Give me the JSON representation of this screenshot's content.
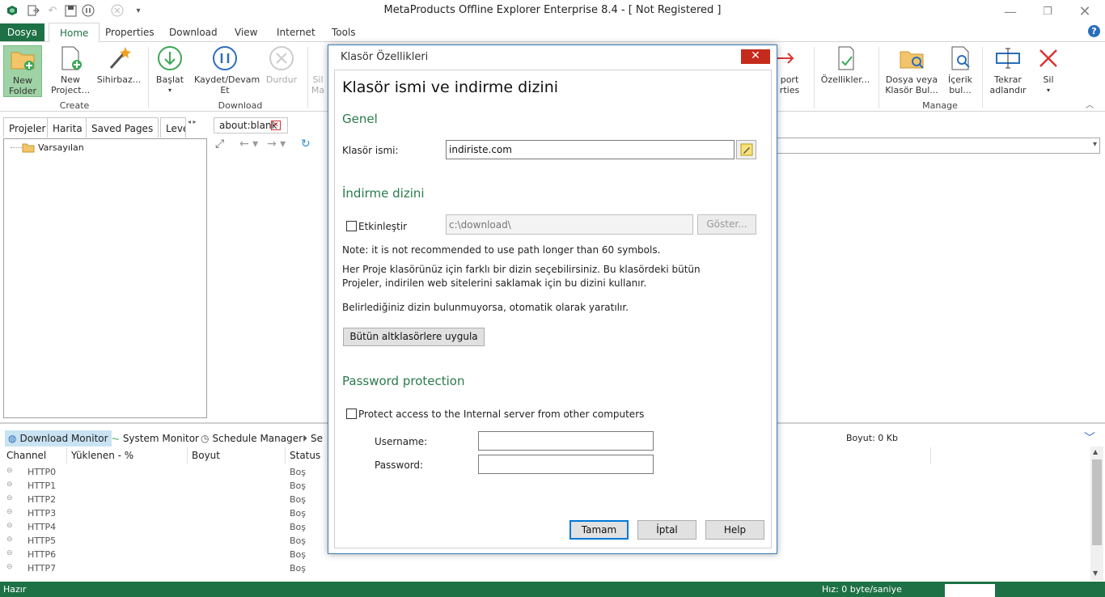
{
  "window": {
    "title": "MetaProducts Offline Explorer Enterprise 8.4 - [ Not Registered ]"
  },
  "ribbon": {
    "file_tab": "Dosya",
    "tabs": [
      "Home",
      "Properties",
      "Download",
      "View",
      "Internet",
      "Tools"
    ],
    "buttons": {
      "new_folder": "New Folder",
      "new_project": "New Project...",
      "wizard": "Sihirbaz...",
      "start": "Başlat",
      "save_resume": "Kaydet/Devam Et",
      "stop": "Durdur",
      "sil_partial": "Sil Ma",
      "export_partial": "port rties",
      "properties": "Özellikler...",
      "find_file": "Dosya veya Klasör Bul...",
      "find_content": "İçerik bul...",
      "rename": "Tekrar adlandır",
      "delete": "Sil"
    },
    "groups": {
      "create": "Create",
      "download": "Download",
      "manage": "Manage"
    }
  },
  "left_panel": {
    "tabs": [
      "Projeler",
      "Harita",
      "Saved Pages",
      "Leve"
    ],
    "tree_root": "Varsayılan"
  },
  "browser": {
    "tab_title": "about:blank"
  },
  "bottom_panel": {
    "tabs": [
      "Download Monitor",
      "System Monitor",
      "Schedule Manager",
      "Se"
    ],
    "size_label": "Boyut: 0 Kb",
    "columns": [
      "Channel",
      "Yüklenen - %",
      "Boyut",
      "Status"
    ],
    "rows": [
      {
        "channel": "HTTP0",
        "status": "Boş"
      },
      {
        "channel": "HTTP1",
        "status": "Boş"
      },
      {
        "channel": "HTTP2",
        "status": "Boş"
      },
      {
        "channel": "HTTP3",
        "status": "Boş"
      },
      {
        "channel": "HTTP4",
        "status": "Boş"
      },
      {
        "channel": "HTTP5",
        "status": "Boş"
      },
      {
        "channel": "HTTP6",
        "status": "Boş"
      },
      {
        "channel": "HTTP7",
        "status": "Boş"
      }
    ]
  },
  "status_bar": {
    "left": "Hazır",
    "speed": "Hız: 0 byte/saniye"
  },
  "dialog": {
    "title": "Klasör Özellikleri",
    "heading": "Klasör ismi ve indirme dizini",
    "general_section": "Genel",
    "folder_name_label": "Klasör ismi:",
    "folder_name_value": "indiriste.com",
    "download_dir_section": "İndirme dizini",
    "enable_label": "Etkinleştir",
    "path_value": "c:\\download\\",
    "browse_button": "Göster...",
    "note": "Note: it is not recommended to use path longer than 60 symbols.",
    "info_line1": "Her Proje klasörünüz için farklı bir dizin seçebilirsiniz. Bu klasördeki bütün",
    "info_line2": "Projeler, indirilen web sitelerini saklamak için bu dizini kullanır.",
    "info_line3": "Belirlediğiniz dizin bulunmuyorsa, otomatik olarak yaratılır.",
    "apply_button": "Bütün altklasörlere uygula",
    "password_section": "Password protection",
    "protect_label": "Protect access to the Internal server from other computers",
    "username_label": "Username:",
    "password_label": "Password:",
    "username_value": "",
    "password_value": "",
    "ok_button": "Tamam",
    "cancel_button": "İptal",
    "help_button": "Help"
  },
  "colors": {
    "accent_green": "#1e7145",
    "section_green": "#2a7a4c",
    "close_red": "#c42b1c"
  }
}
